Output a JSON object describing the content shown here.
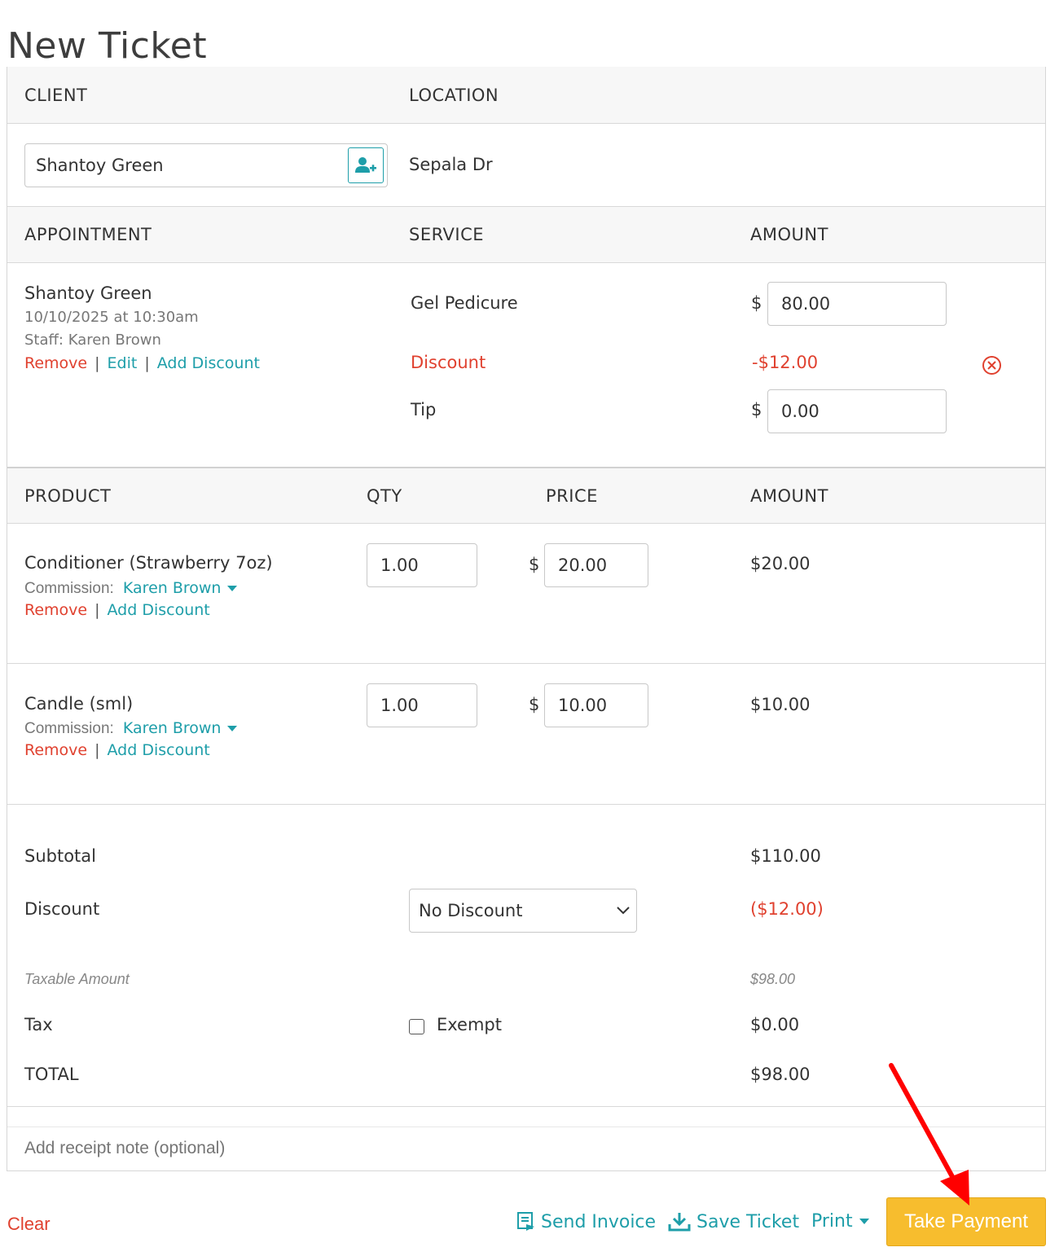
{
  "page": {
    "title": "New Ticket"
  },
  "client_section": {
    "client_header": "CLIENT",
    "location_header": "LOCATION",
    "client_value": "Shantoy Green",
    "location_value": "Sepala Dr"
  },
  "appointment_section": {
    "headers": {
      "appointment": "APPOINTMENT",
      "service": "SERVICE",
      "amount": "AMOUNT"
    },
    "client_name": "Shantoy Green",
    "datetime": "10/10/2025 at 10:30am",
    "staff": "Staff: Karen Brown",
    "links": {
      "remove": "Remove",
      "edit": "Edit",
      "add_discount": "Add Discount",
      "separator": "|"
    },
    "service_name": "Gel Pedicure",
    "service_amount": "80.00",
    "discount_label": "Discount",
    "discount_amount": "-$12.00",
    "tip_label": "Tip",
    "tip_amount": "0.00",
    "currency": "$"
  },
  "product_section": {
    "headers": {
      "product": "PRODUCT",
      "qty": "QTY",
      "price": "PRICE",
      "amount": "AMOUNT"
    },
    "items": [
      {
        "name": "Conditioner (Strawberry 7oz)",
        "commission_label": "Commission:",
        "commission_staff": "Karen Brown",
        "qty": "1.00",
        "price": "20.00",
        "amount": "$20.00",
        "remove": "Remove",
        "add_discount": "Add Discount"
      },
      {
        "name": "Candle (sml)",
        "commission_label": "Commission:",
        "commission_staff": "Karen Brown",
        "qty": "1.00",
        "price": "10.00",
        "amount": "$10.00",
        "remove": "Remove",
        "add_discount": "Add Discount"
      }
    ]
  },
  "totals": {
    "subtotal_label": "Subtotal",
    "subtotal_value": "$110.00",
    "discount_label": "Discount",
    "discount_select": "No Discount",
    "discount_value": "($12.00)",
    "taxable_label": "Taxable Amount",
    "taxable_value": "$98.00",
    "tax_label": "Tax",
    "exempt_label": "Exempt",
    "tax_value": "$0.00",
    "total_label": "TOTAL",
    "total_value": "$98.00"
  },
  "receipt_note": {
    "placeholder": "Add receipt note (optional)"
  },
  "footer": {
    "clear": "Clear",
    "send_invoice": "Send Invoice",
    "save_ticket": "Save Ticket",
    "print": "Print",
    "take_payment": "Take Payment"
  },
  "colors": {
    "accent": "#1e9ea9",
    "danger": "#e0412f",
    "primary_button": "#f7bd2e",
    "annotation_arrow": "#ff0000"
  }
}
